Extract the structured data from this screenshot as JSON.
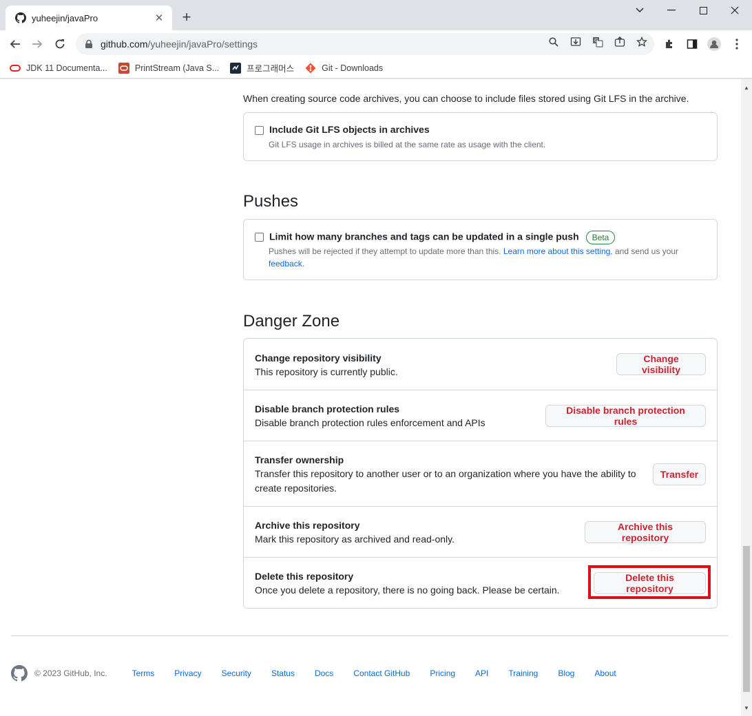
{
  "browser": {
    "tab_title": "yuheejin/javaPro",
    "url_host": "github.com",
    "url_path": "/yuheejin/javaPro/settings",
    "bookmarks": [
      {
        "label": "JDK 11 Documenta...",
        "icon": "oracle-icon"
      },
      {
        "label": "PrintStream (Java S...",
        "icon": "oracle-icon"
      },
      {
        "label": "프로그래머스",
        "icon": "programmers-icon"
      },
      {
        "label": "Git - Downloads",
        "icon": "git-icon"
      }
    ]
  },
  "archives": {
    "intro": "When creating source code archives, you can choose to include files stored using Git LFS in the archive.",
    "lfs_label": "Include Git LFS objects in archives",
    "lfs_note": "Git LFS usage in archives is billed at the same rate as usage with the client."
  },
  "pushes": {
    "heading": "Pushes",
    "limit_label": "Limit how many branches and tags can be updated in a single push",
    "beta_badge": "Beta",
    "note_prefix": "Pushes will be rejected if they attempt to update more than this. ",
    "learn_more": "Learn more about this setting",
    "note_middle": ", and send us your",
    "feedback": "feedback",
    "note_end": "."
  },
  "danger_zone": {
    "heading": "Danger Zone",
    "rows": [
      {
        "title": "Change repository visibility",
        "desc": "This repository is currently public.",
        "button": "Change visibility"
      },
      {
        "title": "Disable branch protection rules",
        "desc": "Disable branch protection rules enforcement and APIs",
        "button": "Disable branch protection rules"
      },
      {
        "title": "Transfer ownership",
        "desc": "Transfer this repository to another user or to an organization where you have the ability to create repositories.",
        "button": "Transfer"
      },
      {
        "title": "Archive this repository",
        "desc": "Mark this repository as archived and read-only.",
        "button": "Archive this repository"
      },
      {
        "title": "Delete this repository",
        "desc": "Once you delete a repository, there is no going back. Please be certain.",
        "button": "Delete this repository"
      }
    ]
  },
  "footer": {
    "copyright": "© 2023 GitHub, Inc.",
    "links": [
      "Terms",
      "Privacy",
      "Security",
      "Status",
      "Docs",
      "Contact GitHub",
      "Pricing",
      "API",
      "Training",
      "Blog",
      "About"
    ]
  },
  "colors": {
    "danger": "#cf222e",
    "link": "#0969da",
    "highlight": "#e00c1a",
    "beta": "#1a7f37"
  }
}
